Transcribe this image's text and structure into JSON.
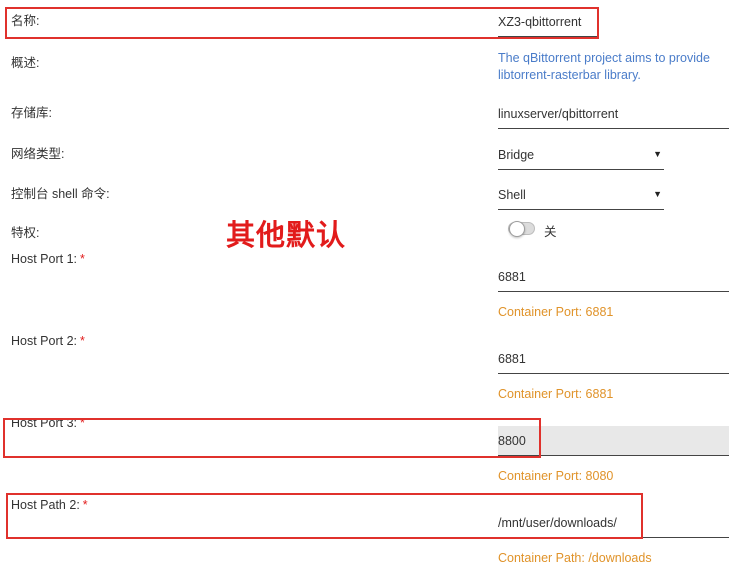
{
  "colors": {
    "link": "#4a7cc9",
    "hint": "#e0932a",
    "required": "#e21b1b",
    "highlight": "#e0312c"
  },
  "fields": {
    "name": {
      "label": "名称:",
      "value": "XZ3-qbittorrent"
    },
    "overview": {
      "label": "概述:",
      "value": "The qBittorrent project aims to provide libtorrent-rasterbar library."
    },
    "repository": {
      "label": "存储库:",
      "value": "linuxserver/qbittorrent"
    },
    "network_type": {
      "label": "网络类型:",
      "value": "Bridge"
    },
    "console_shell": {
      "label": "控制台 shell 命令:",
      "value": "Shell"
    },
    "privileged": {
      "label": "特权:",
      "value": "关",
      "state": false
    },
    "host_port_1": {
      "label": "Host Port 1:",
      "required": "*",
      "value": "6881",
      "hint": "Container Port: 6881"
    },
    "host_port_2": {
      "label": "Host Port 2:",
      "required": "*",
      "value": "6881",
      "hint": "Container Port: 6881"
    },
    "host_port_3": {
      "label": "Host Port 3:",
      "required": "*",
      "value": "8800",
      "hint": "Container Port: 8080"
    },
    "host_path_2": {
      "label": "Host Path 2:",
      "required": "*",
      "value": "/mnt/user/downloads/",
      "hint": "Container Path: /downloads"
    }
  },
  "annotation": {
    "text": "其他默认"
  },
  "icons": {
    "dropdown": "caret-down-icon"
  }
}
